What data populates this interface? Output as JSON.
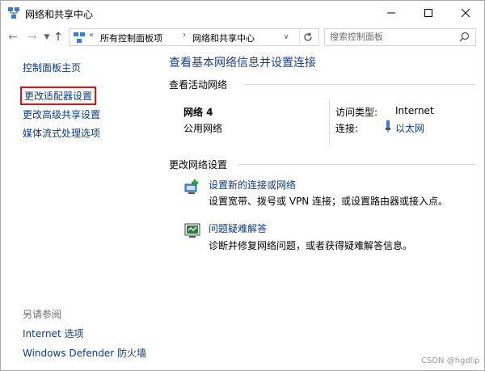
{
  "window": {
    "title": "网络和共享中心"
  },
  "address": {
    "overflow": "«",
    "crumbs": [
      "所有控制面板项",
      "网络和共享中心"
    ],
    "separator": "›"
  },
  "search": {
    "placeholder": "搜索控制面板"
  },
  "sidebar": {
    "home": "控制面板主页",
    "items": [
      "更改适配器设置",
      "更改高级共享设置",
      "媒体流式处理选项"
    ],
    "see_also_title": "另请参阅",
    "see_also": [
      "Internet 选项",
      "Windows Defender 防火墙"
    ]
  },
  "main": {
    "title": "查看基本网络信息并设置连接",
    "active_section": "查看活动网络",
    "network": {
      "name": "网络 4",
      "type": "公用网络",
      "access_label": "访问类型:",
      "access_value": "Internet",
      "connection_label": "连接:",
      "connection_value": "以太网"
    },
    "change_section": "更改网络设置",
    "tasks": [
      {
        "title": "设置新的连接或网络",
        "desc": "设置宽带、拨号或 VPN 连接；或设置路由器或接入点。"
      },
      {
        "title": "问题疑难解答",
        "desc": "诊断并修复网络问题，或者获得疑难解答信息。"
      }
    ]
  },
  "watermark": "CSDN @hgdlip",
  "colors": {
    "link": "#0b3a8c",
    "title": "#1e3f8a",
    "highlight_border": "#d91616"
  }
}
